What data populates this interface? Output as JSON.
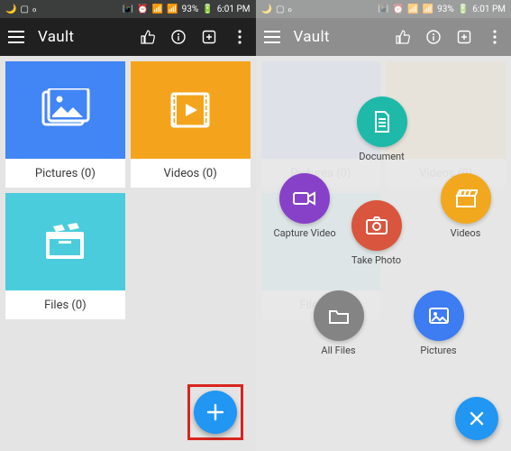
{
  "status": {
    "battery": "93%",
    "time": "6:01 PM"
  },
  "header": {
    "title": "Vault"
  },
  "tiles": {
    "pictures": {
      "label": "Pictures (0)"
    },
    "videos": {
      "label": "Videos (0)"
    },
    "files": {
      "label": "Files (0)"
    }
  },
  "radial_menu": {
    "document": {
      "label": "Document"
    },
    "capture_video": {
      "label": "Capture Video"
    },
    "videos": {
      "label": "Videos"
    },
    "take_photo": {
      "label": "Take Photo"
    },
    "all_files": {
      "label": "All Files"
    },
    "pictures": {
      "label": "Pictures"
    }
  }
}
